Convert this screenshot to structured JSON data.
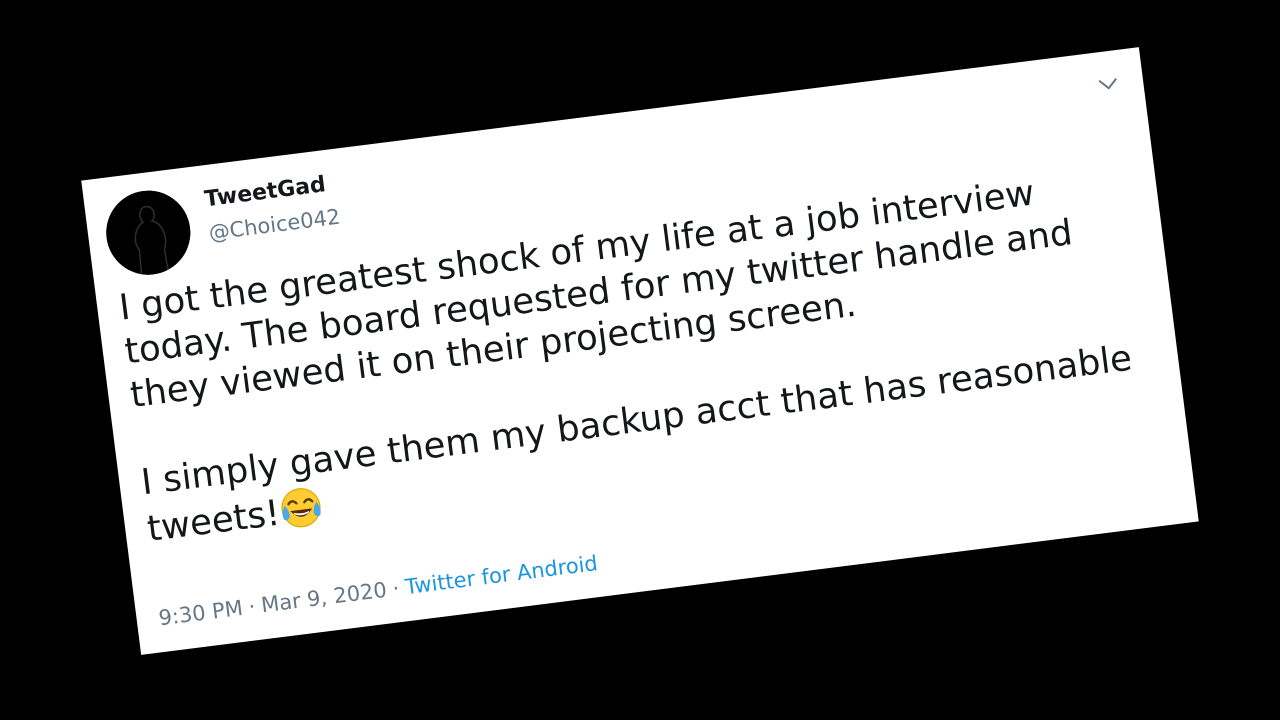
{
  "tweet": {
    "author_name": "TweetGad",
    "author_handle": "@Choice042",
    "text_line1": "I got the greatest shock of my life at a job interview",
    "text_line2": "today. The board requested for my twitter handle and",
    "text_line3": "they viewed it on their projecting screen.",
    "text_line4": "I simply gave them my backup acct that has reasonable",
    "text_line5": "tweets!",
    "emoji_icon": "face-with-tears-of-joy-icon",
    "time": "9:30 PM",
    "separator": "·",
    "date": "Mar 9, 2020",
    "source": "Twitter for Android"
  },
  "colors": {
    "background": "#000000",
    "card": "#ffffff",
    "text": "#14171a",
    "muted": "#657786",
    "link": "#1b95e0"
  }
}
